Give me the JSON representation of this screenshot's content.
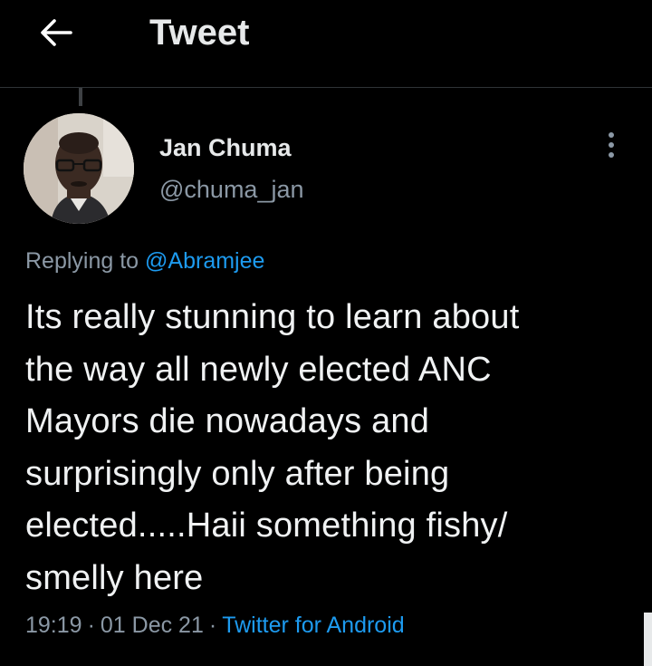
{
  "header": {
    "back_icon": "arrow-left-icon",
    "title": "Tweet"
  },
  "tweet": {
    "author_name": "Jan Chuma",
    "author_handle": "@chuma_jan",
    "more_icon": "vertical-dots-icon",
    "replying_prefix": "Replying to ",
    "replying_to": "@Abramjee",
    "text": "Its really stunning to learn about\nthe way all newly elected ANC\nMayors die nowadays and\nsurprisingly only after being\nelected.....Haii something fishy/\nsmelly here",
    "time": "19:19",
    "separator": "·",
    "date": "01 Dec 21",
    "source": "Twitter for Android"
  },
  "colors": {
    "background": "#000000",
    "text": "#e7e9ea",
    "secondary_text": "#8b98a5",
    "link": "#1d9bf0"
  }
}
